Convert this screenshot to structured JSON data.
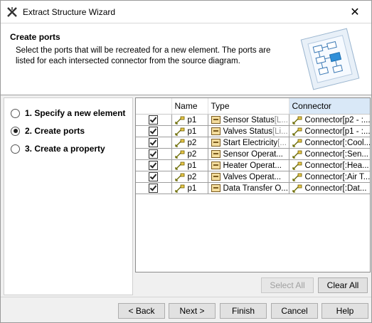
{
  "window": {
    "title": "Extract Structure Wizard",
    "close_glyph": "✕"
  },
  "header": {
    "title": "Create ports",
    "description": "Select the ports that will be recreated for a new element. The ports are listed for each intersected connector from the source diagram."
  },
  "steps": [
    {
      "label": "1. Specify a new element",
      "selected": false
    },
    {
      "label": "2. Create ports",
      "selected": true
    },
    {
      "label": "3. Create a property",
      "selected": false
    }
  ],
  "table": {
    "columns": [
      "",
      "Name",
      "Type",
      "Connector"
    ],
    "rows": [
      {
        "checked": true,
        "name": "p1",
        "type": "Sensor Status",
        "type_suffix": " [L...",
        "connector": "Connector[p2 - :..."
      },
      {
        "checked": true,
        "name": "p1",
        "type": "Valves Status",
        "type_suffix": " [Li...",
        "connector": "Connector[p1 - :..."
      },
      {
        "checked": true,
        "name": "p2",
        "type": "Start Electricity",
        "type_suffix": " [...",
        "connector": "Connector[:Cool..."
      },
      {
        "checked": true,
        "name": "p2",
        "type": "Sensor Operat...",
        "type_suffix": "",
        "connector": "Connector[:Sen..."
      },
      {
        "checked": true,
        "name": "p1",
        "type": "Heater Operat...",
        "type_suffix": "",
        "connector": "Connector[:Hea..."
      },
      {
        "checked": true,
        "name": "p2",
        "type": "Valves Operat...",
        "type_suffix": "",
        "connector": "Connector[:Air T..."
      },
      {
        "checked": true,
        "name": "p1",
        "type": "Data Transfer O...",
        "type_suffix": "",
        "connector": "Connector[:Dat..."
      }
    ]
  },
  "table_buttons": {
    "select_all": "Select All",
    "clear_all": "Clear All"
  },
  "footer": {
    "back": "< Back",
    "next": "Next >",
    "finish": "Finish",
    "cancel": "Cancel",
    "help": "Help"
  }
}
